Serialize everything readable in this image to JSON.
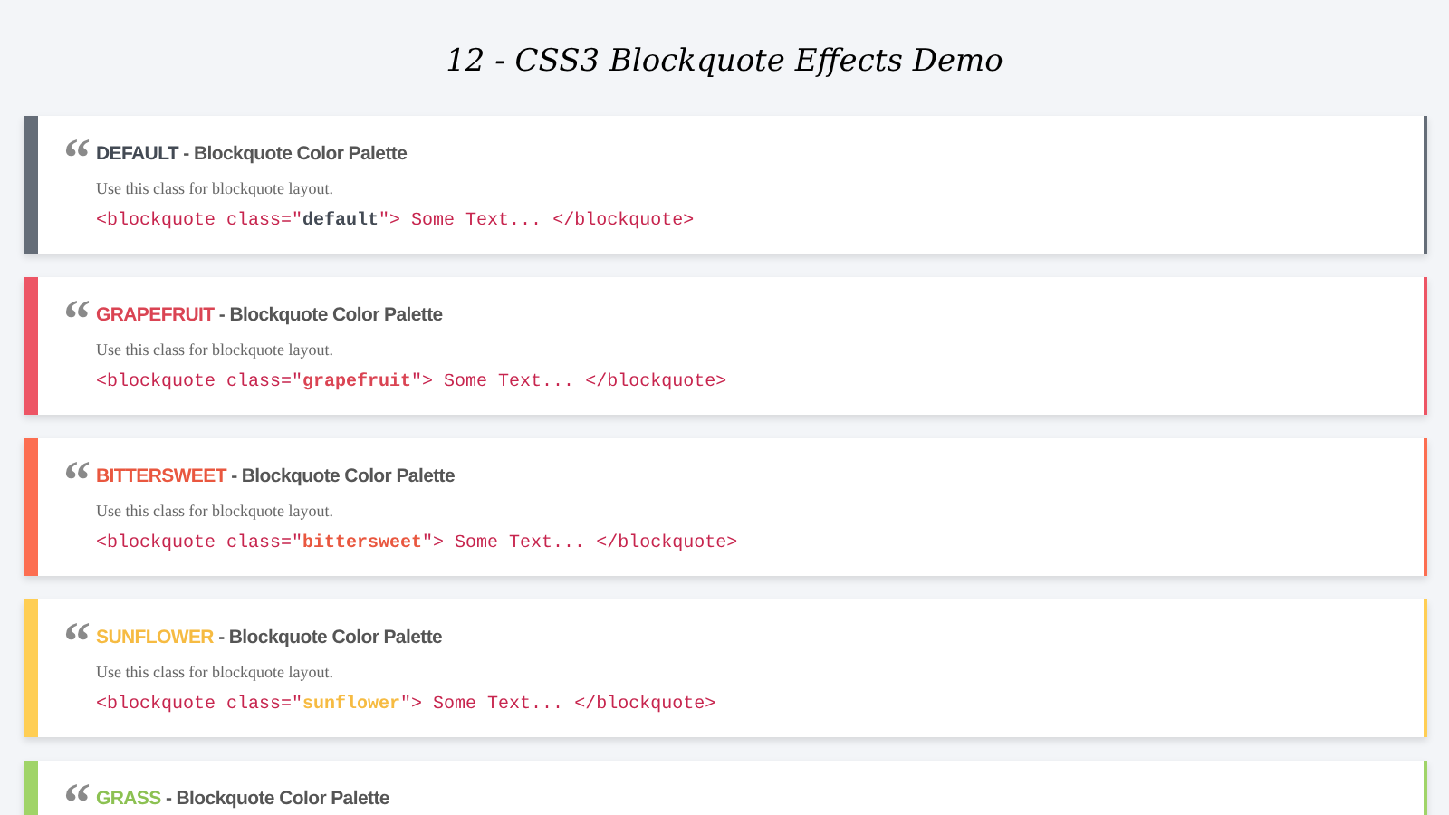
{
  "title": "12 - CSS3 Blockquote Effects Demo",
  "quotes": [
    {
      "mark": "“",
      "label": {
        "text": "DEFAULT",
        "color": "#434a54"
      },
      "heading": " - Blockquote Color Palette",
      "color": "#656d78",
      "description": "Use this class for blockquote layout.",
      "code_before": "<blockquote class=\"",
      "code_class": "default",
      "code_after": "\"> Some Text... </blockquote>"
    },
    {
      "mark": "“",
      "label": {
        "text": "GRAPEFRUIT",
        "color": "#da4453"
      },
      "heading": " - Blockquote Color Palette",
      "color": "#ed5565",
      "description": "Use this class for blockquote layout.",
      "code_before": "<blockquote class=\"",
      "code_class": "grapefruit",
      "code_after": "\"> Some Text... </blockquote>"
    },
    {
      "mark": "“",
      "label": {
        "text": "BITTERSWEET",
        "color": "#e9573f"
      },
      "heading": " - Blockquote Color Palette",
      "color": "#fc6e51",
      "description": "Use this class for blockquote layout.",
      "code_before": "<blockquote class=\"",
      "code_class": "bittersweet",
      "code_after": "\"> Some Text... </blockquote>"
    },
    {
      "mark": "“",
      "label": {
        "text": "SUNFLOWER",
        "color": "#f6bb42"
      },
      "heading": " - Blockquote Color Palette",
      "color": "#ffce54",
      "description": "Use this class for blockquote layout.",
      "code_before": "<blockquote class=\"",
      "code_class": "sunflower",
      "code_after": "\"> Some Text... </blockquote>"
    },
    {
      "mark": "“",
      "label": {
        "text": "GRASS",
        "color": "#8cc152"
      },
      "heading": " - Blockquote Color Palette",
      "color": "#a0d468"
    }
  ]
}
